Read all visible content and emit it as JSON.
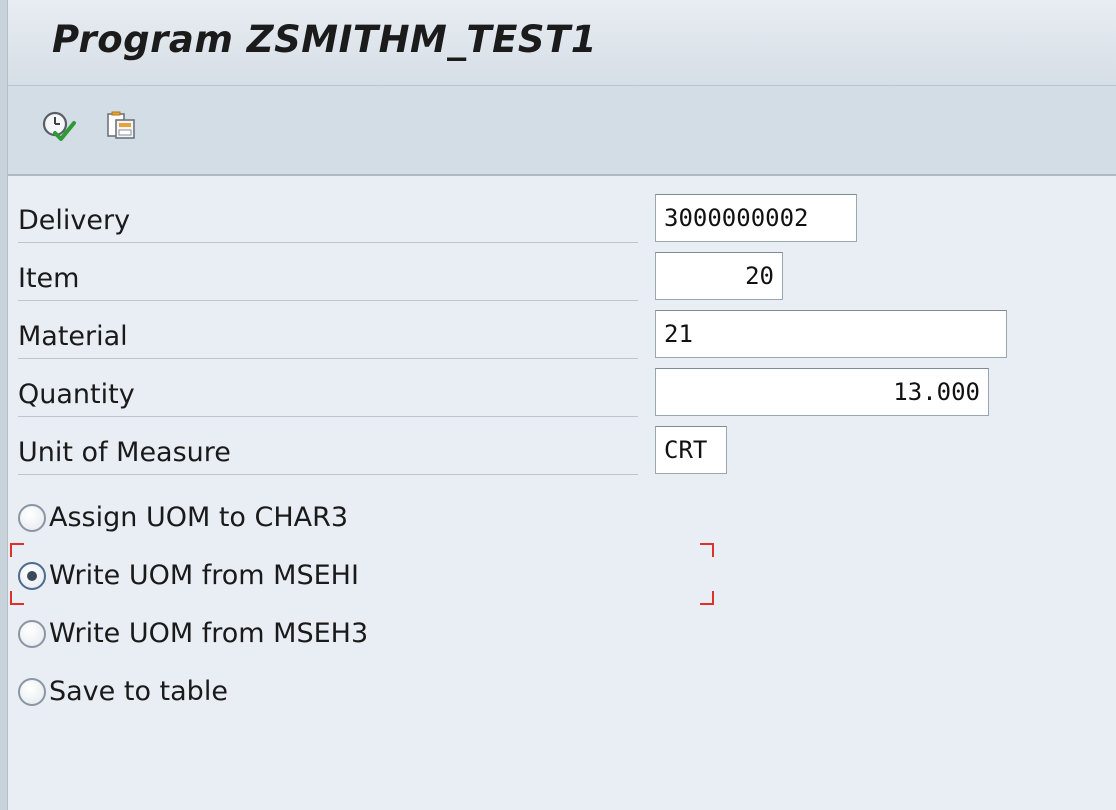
{
  "window": {
    "title": "Program ZSMITHM_TEST1"
  },
  "toolbar": {
    "execute_icon": "execute-clock-check-icon",
    "variant_icon": "get-variant-icon"
  },
  "fields": [
    {
      "id": "delivery",
      "label": "Delivery",
      "value": "3000000002",
      "align": "left"
    },
    {
      "id": "item",
      "label": "Item",
      "value": "20",
      "align": "right"
    },
    {
      "id": "material",
      "label": "Material",
      "value": "21",
      "align": "left"
    },
    {
      "id": "quantity",
      "label": "Quantity",
      "value": "13.000",
      "align": "right"
    },
    {
      "id": "uom",
      "label": "Unit of Measure",
      "value": "CRT",
      "align": "left"
    }
  ],
  "options": [
    {
      "id": "assign",
      "label": "Assign UOM to CHAR3",
      "selected": false
    },
    {
      "id": "msehi",
      "label": "Write UOM from MSEHI",
      "selected": true
    },
    {
      "id": "mseh3",
      "label": "Write UOM from MSEH3",
      "selected": false
    },
    {
      "id": "save",
      "label": "Save to table",
      "selected": false
    }
  ],
  "colors": {
    "background": "#e9eef4",
    "title_bar": "#dde4eb",
    "toolbar": "#d3dde6",
    "focus_marker": "#e0302a"
  }
}
